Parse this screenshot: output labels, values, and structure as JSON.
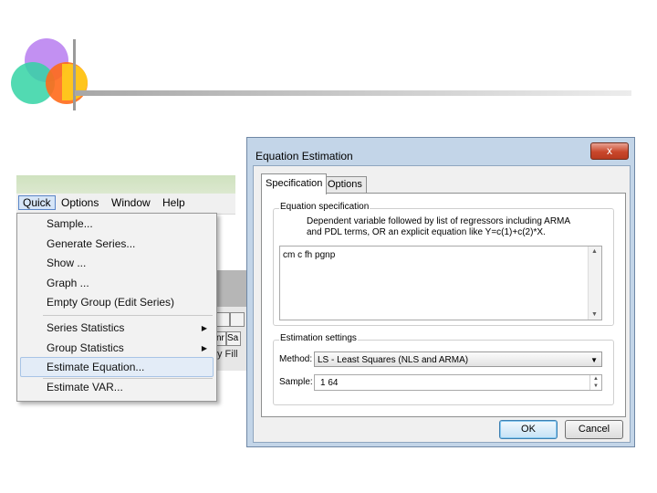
{
  "menubar": {
    "items": [
      "Quick",
      "Options",
      "Window",
      "Help"
    ]
  },
  "quick_menu": {
    "items": [
      {
        "label": "Sample..."
      },
      {
        "label": "Generate Series..."
      },
      {
        "label": "Show ..."
      },
      {
        "label": "Graph ..."
      },
      {
        "label": "Empty Group (Edit Series)"
      },
      {
        "label": "Series Statistics"
      },
      {
        "label": "Group Statistics"
      },
      {
        "label": "Estimate Equation..."
      },
      {
        "label": "Estimate VAR..."
      }
    ]
  },
  "background_window": {
    "tab_stub_1": "nr",
    "tab_stub_2": "Sa",
    "partial_label": "y Fill"
  },
  "dialog": {
    "title": "Equation Estimation",
    "close_glyph": "x",
    "tabs": [
      "Specification",
      "Options"
    ],
    "equation_specification": {
      "legend": "Equation specification",
      "hint_line1": "Dependent variable followed by list of regressors including ARMA",
      "hint_line2": "and PDL terms, OR an explicit equation like Y=c(1)+c(2)*X.",
      "value": "cm c fh pgnp"
    },
    "estimation_settings": {
      "legend": "Estimation settings",
      "method_label": "Method:",
      "method_value": "LS - Least Squares (NLS and ARMA)",
      "sample_label": "Sample:",
      "sample_value": "1 64"
    },
    "ok_label": "OK",
    "cancel_label": "Cancel"
  }
}
